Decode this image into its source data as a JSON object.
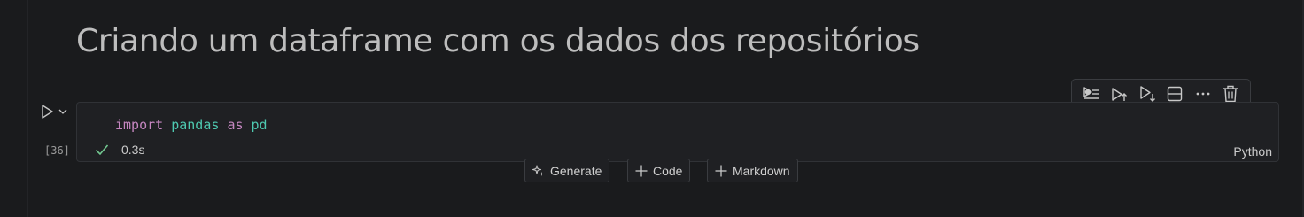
{
  "markdown": {
    "heading": "Criando um dataframe com os dados dos repositórios"
  },
  "code_cell": {
    "execution_count": "[36]",
    "code": {
      "kw_import": "import",
      "module": "pandas",
      "kw_as": "as",
      "alias": "pd"
    },
    "status_time": "0.3s",
    "language": "Python"
  },
  "cell_toolbar": {
    "icons": [
      "run-above-icon",
      "execute-above-icon",
      "execute-below-icon",
      "split-cell-icon",
      "more-icon",
      "delete-icon"
    ]
  },
  "insert_bar": {
    "generate_label": "Generate",
    "code_label": "Code",
    "markdown_label": "Markdown"
  },
  "colors": {
    "background": "#1a1b1d",
    "keyword": "#c586c0",
    "module": "#4ec9b0",
    "success": "#73c991",
    "text": "#cccccc"
  }
}
